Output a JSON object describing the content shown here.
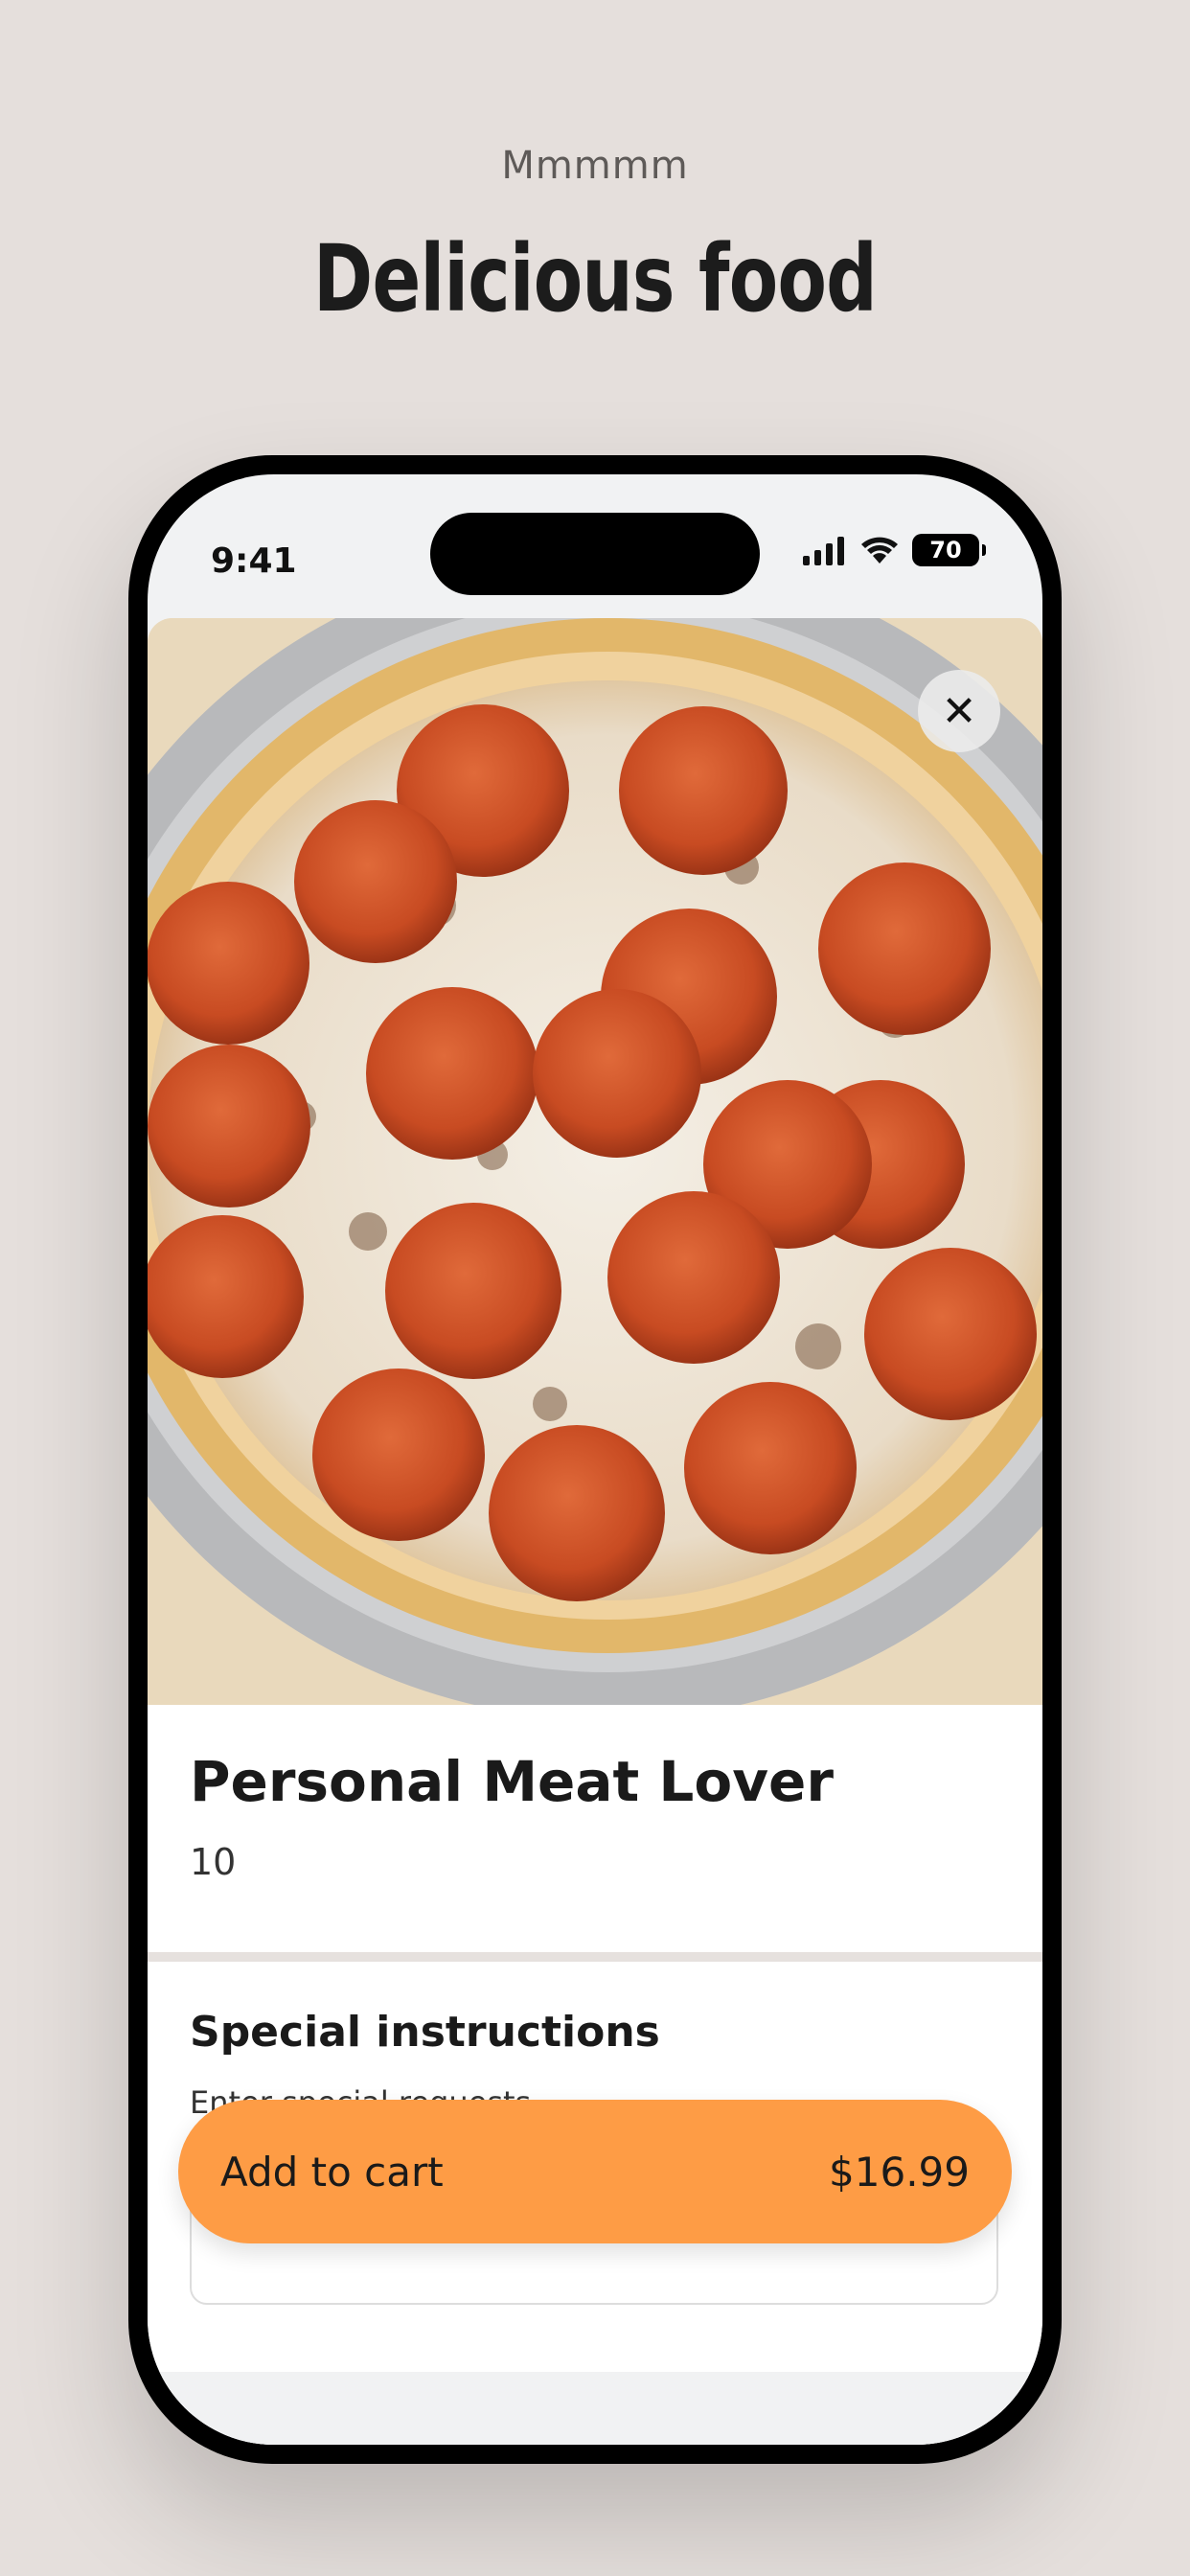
{
  "header": {
    "tagline": "Mmmmm",
    "headline": "Delicious food"
  },
  "status_bar": {
    "time": "9:41",
    "battery": "70"
  },
  "product": {
    "name": "Personal Meat Lover",
    "size": "10"
  },
  "special_instructions": {
    "title": "Special instructions",
    "subtitle": "Enter special requests",
    "placeholder": "Enter special requests"
  },
  "cart": {
    "label": "Add to cart",
    "price": "$16.99"
  },
  "colors": {
    "background": "#e5dfdc",
    "accent": "#fe9c45",
    "text": "#1a1a1a"
  }
}
